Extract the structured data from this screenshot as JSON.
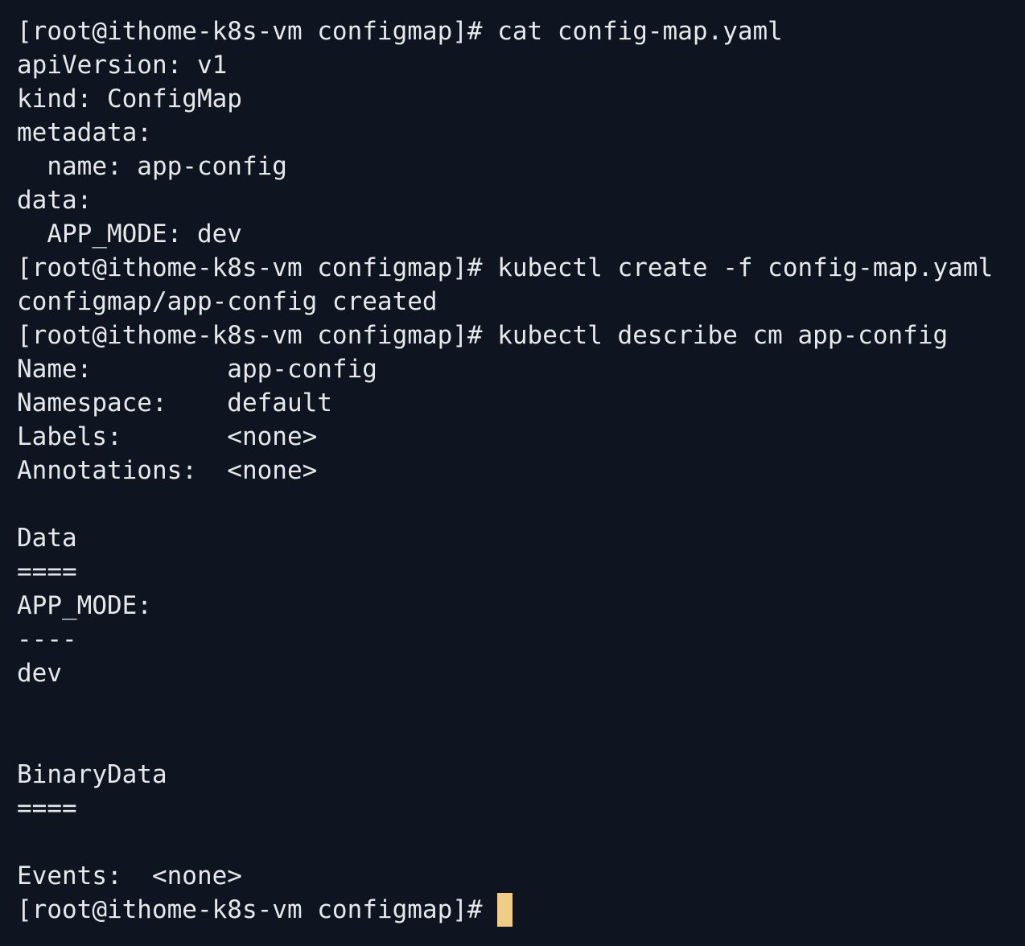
{
  "terminal": {
    "colors": {
      "background": "#0e1520",
      "foreground": "#e6e8eb",
      "cursor": "#f0cd86"
    },
    "lines": [
      "[root@ithome-k8s-vm configmap]# cat config-map.yaml",
      "apiVersion: v1",
      "kind: ConfigMap",
      "metadata:",
      "  name: app-config",
      "data:",
      "  APP_MODE: dev",
      "[root@ithome-k8s-vm configmap]# kubectl create -f config-map.yaml",
      "configmap/app-config created",
      "[root@ithome-k8s-vm configmap]# kubectl describe cm app-config",
      "Name:         app-config",
      "Namespace:    default",
      "Labels:       <none>",
      "Annotations:  <none>",
      "",
      "Data",
      "====",
      "APP_MODE:",
      "----",
      "dev",
      "",
      "",
      "BinaryData",
      "====",
      "",
      "Events:  <none>"
    ],
    "prompt": "[root@ithome-k8s-vm configmap]# ",
    "cursor_icon": "block-cursor-icon"
  }
}
